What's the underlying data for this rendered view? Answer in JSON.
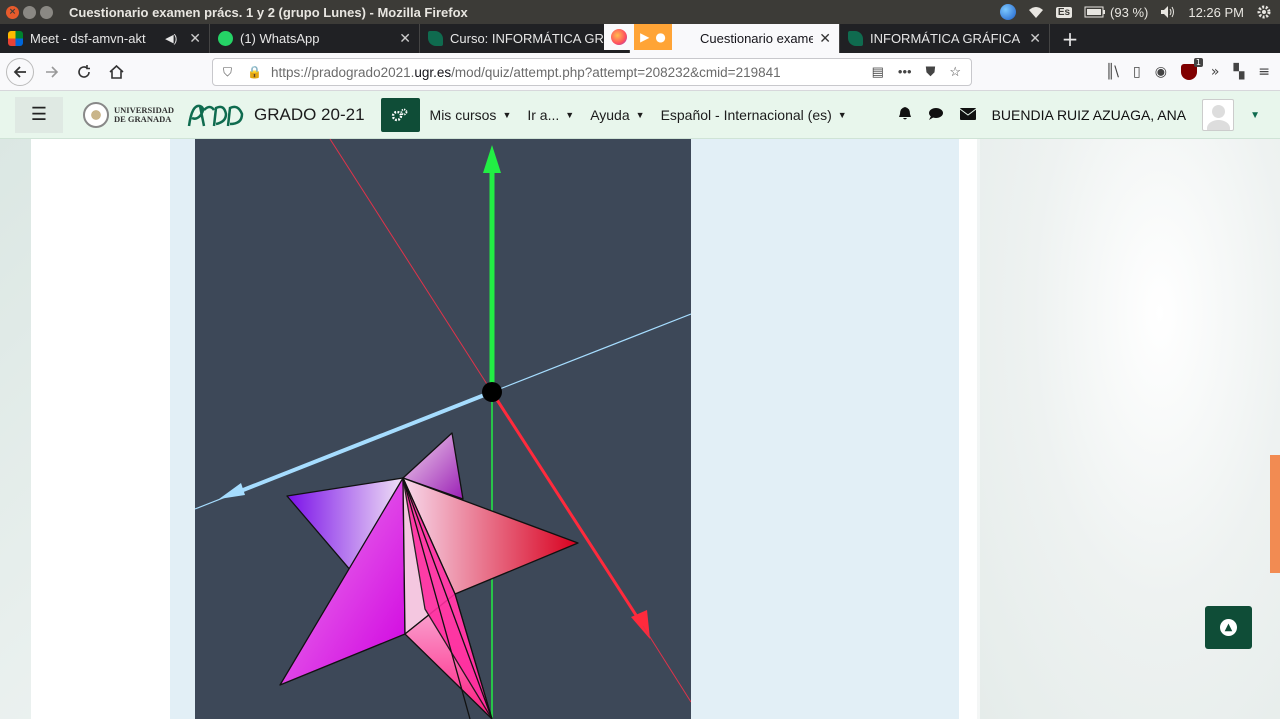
{
  "os": {
    "window_title": "Cuestionario examen prács. 1 y 2 (grupo Lunes) - Mozilla Firefox",
    "keyboard_layout": "Es",
    "battery": "(93 %)",
    "clock": "12:26 PM"
  },
  "browser": {
    "tabs": [
      {
        "label": "Meet - dsf-amvn-akt",
        "icon": "meet-icon"
      },
      {
        "label": "(1) WhatsApp",
        "icon": "whatsapp-icon"
      },
      {
        "label": "Curso: INFORMÁTICA GR",
        "icon": "prado-icon"
      },
      {
        "label": "Cuestionario examen prács",
        "icon": "prado-icon",
        "active": true
      },
      {
        "label": "INFORMÁTICA GRÁFICA",
        "icon": "prado-icon"
      }
    ],
    "url_prefix": "https://pradogrado2021.",
    "url_domain": "ugr.es",
    "url_path": "/mod/quiz/attempt.php?attempt=208232&cmid=219841",
    "ublock_badge": "1"
  },
  "moodle": {
    "university_line1": "UNIVERSIDAD",
    "university_line2": "DE GRANADA",
    "site_name": "GRADO 20-21",
    "menu": [
      "Mis cursos",
      "Ir a...",
      "Ayuda",
      "Español - Internacional (es)"
    ],
    "user_name": "BUENDIA RUIZ AZUAGA, ANA"
  },
  "colors": {
    "header_bg": "#e8f6ec",
    "brand_dark": "#0f4d37",
    "canvas_bg": "#3d4858",
    "axis_x": "#ff2a3c",
    "axis_y": "#22ee44",
    "axis_z": "#a6ddff"
  }
}
